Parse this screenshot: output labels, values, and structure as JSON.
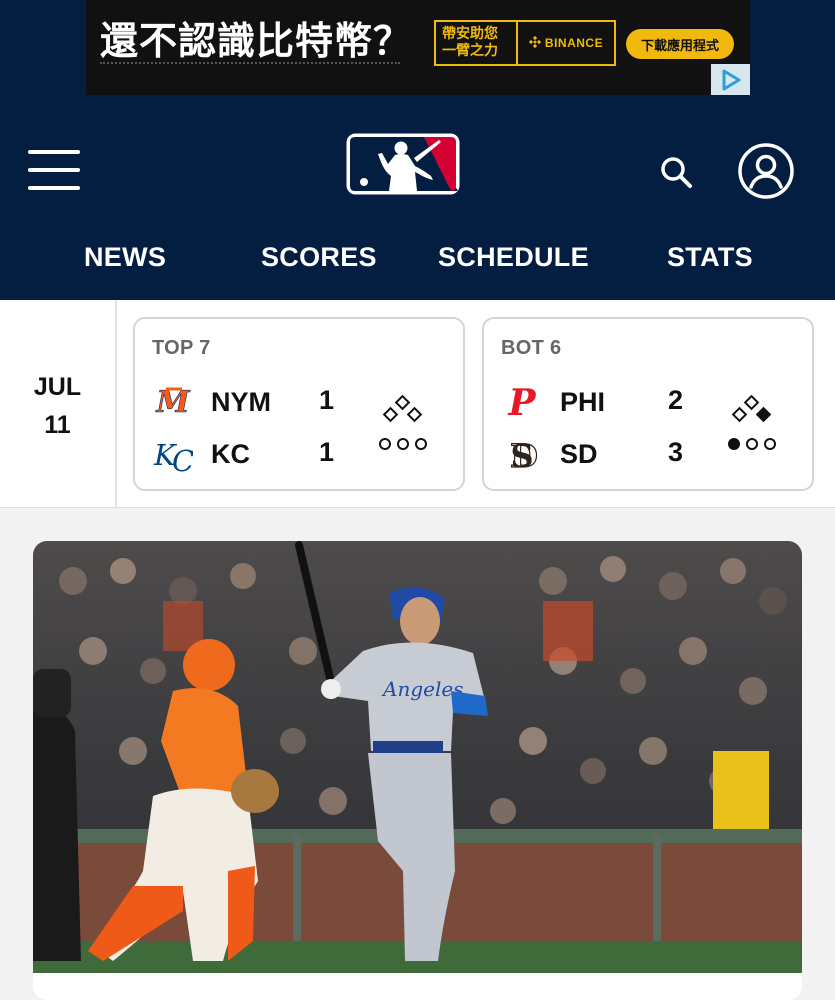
{
  "ad": {
    "headline": "還不認識比特幣？",
    "tagline": "帶安助您一臂之力",
    "brand": "BINANCE",
    "cta": "下載應用程式"
  },
  "header": {
    "logo_icon": "mlb-logo-icon",
    "menu_icon": "hamburger-menu-icon",
    "search_icon": "search-icon",
    "account_icon": "account-icon",
    "colors": {
      "navy": "#041e42",
      "red": "#d50032",
      "blue": "#041e42"
    }
  },
  "nav": {
    "items": [
      {
        "label": "NEWS"
      },
      {
        "label": "SCORES"
      },
      {
        "label": "SCHEDULE"
      },
      {
        "label": "STATS"
      }
    ]
  },
  "scoreboard": {
    "date": {
      "month": "JUL",
      "day": "11"
    },
    "games": [
      {
        "status": "TOP 7",
        "away": {
          "abbr": "NYM",
          "score": "1",
          "logo_icon": "mets-logo-icon",
          "color": "#ff5910"
        },
        "home": {
          "abbr": "KC",
          "score": "1",
          "logo_icon": "royals-logo-icon",
          "color": "#004687"
        },
        "runners": {
          "first": false,
          "second": false,
          "third": false
        },
        "outs": 0
      },
      {
        "status": "BOT 6",
        "away": {
          "abbr": "PHI",
          "score": "2",
          "logo_icon": "phillies-logo-icon",
          "color": "#e81828"
        },
        "home": {
          "abbr": "SD",
          "score": "3",
          "logo_icon": "padres-logo-icon",
          "color": "#2f241d"
        },
        "runners": {
          "first": true,
          "second": false,
          "third": false
        },
        "outs": 1
      }
    ]
  },
  "article": {
    "image_icon": "baseball-photo-image"
  }
}
